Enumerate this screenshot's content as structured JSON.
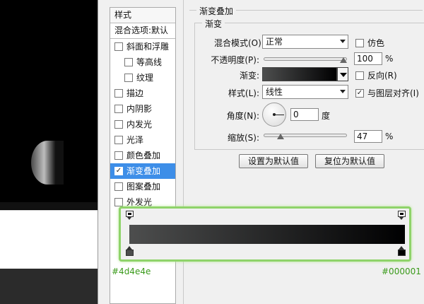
{
  "style_list": {
    "header": "样式",
    "blend_options": "混合选项:默认",
    "items": [
      {
        "label": "斜面和浮雕",
        "checked": false,
        "sub": false,
        "selected": false
      },
      {
        "label": "等高线",
        "checked": false,
        "sub": true,
        "selected": false
      },
      {
        "label": "纹理",
        "checked": false,
        "sub": true,
        "selected": false
      },
      {
        "label": "描边",
        "checked": false,
        "sub": false,
        "selected": false
      },
      {
        "label": "内阴影",
        "checked": false,
        "sub": false,
        "selected": false
      },
      {
        "label": "内发光",
        "checked": false,
        "sub": false,
        "selected": false
      },
      {
        "label": "光泽",
        "checked": false,
        "sub": false,
        "selected": false
      },
      {
        "label": "颜色叠加",
        "checked": false,
        "sub": false,
        "selected": false
      },
      {
        "label": "渐变叠加",
        "checked": true,
        "sub": false,
        "selected": true
      },
      {
        "label": "图案叠加",
        "checked": false,
        "sub": false,
        "selected": false
      },
      {
        "label": "外发光",
        "checked": false,
        "sub": false,
        "selected": false
      }
    ]
  },
  "panel": {
    "outer_legend": "渐变叠加",
    "inner_legend": "渐变",
    "blend_mode_label": "混合模式(O):",
    "blend_mode_value": "正常",
    "dither_label": "仿色",
    "opacity_label": "不透明度(P):",
    "opacity_value": "100",
    "percent": "%",
    "gradient_label": "渐变:",
    "reverse_label": "反向(R)",
    "style_label": "样式(L):",
    "style_value": "线性",
    "align_label": "与图层对齐(I)",
    "align_checked": "✓",
    "angle_label": "角度(N):",
    "angle_value": "0",
    "degree": "度",
    "scale_label": "缩放(S):",
    "scale_value": "47",
    "set_default": "设置为默认值",
    "reset_default": "复位为默认值"
  },
  "gradient_editor": {
    "start_color": "#4d4e4e",
    "end_color": "#000001"
  }
}
